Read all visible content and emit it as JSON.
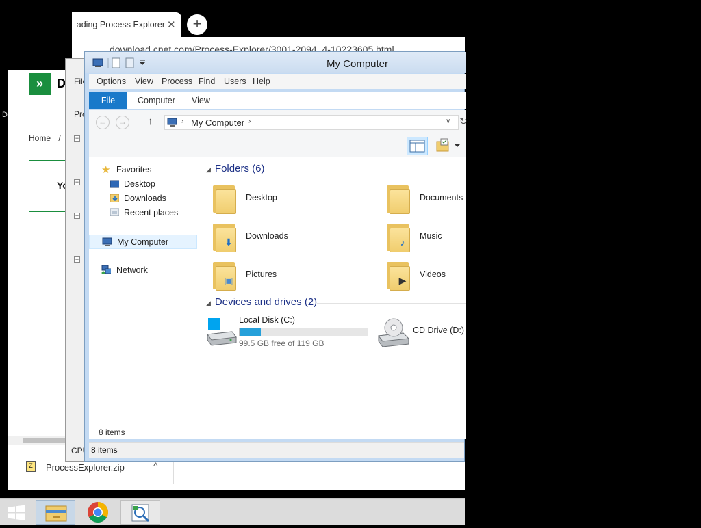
{
  "browser": {
    "tab_title": "Thank you for downloading Process Explorer",
    "tab_close_glyph": "✕",
    "new_tab_glyph": "+",
    "url": "download.cnet.com/Process-Explorer/3001-2094_4-10223605.html",
    "page_logo_glyph": "»",
    "page_logo_text": "D",
    "breadcrumb_home": "Home",
    "breadcrumb_sep": "/",
    "page_box_text": "Yo",
    "left_edge_text": "D",
    "download_file": "ProcessExplorer.zip",
    "download_chevron": "^"
  },
  "procexp": {
    "menu_file": "File",
    "col_process": "Proc",
    "cpu_label": "CPU"
  },
  "explorer": {
    "title": "My Computer",
    "menu": [
      "Options",
      "View",
      "Process",
      "Find",
      "Users",
      "Help"
    ],
    "ribbon_tabs": {
      "file": "File",
      "computer": "Computer",
      "view": "View"
    },
    "address": "My Computer",
    "address_sep": "›",
    "nav": {
      "favorites": "Favorites",
      "desktop": "Desktop",
      "downloads": "Downloads",
      "recent": "Recent places",
      "my_computer": "My Computer",
      "network": "Network"
    },
    "folders_header": "Folders (6)",
    "folders": [
      {
        "name": "Desktop",
        "badge": ""
      },
      {
        "name": "Documents",
        "badge": ""
      },
      {
        "name": "Downloads",
        "badge": "⬇"
      },
      {
        "name": "Music",
        "badge": "♪"
      },
      {
        "name": "Pictures",
        "badge": "▣"
      },
      {
        "name": "Videos",
        "badge": "▶"
      }
    ],
    "devices_header": "Devices and drives (2)",
    "drive_c": {
      "name": "Local Disk (C:)",
      "free": "99.5 GB free of 119 GB",
      "used_fraction": 0.164
    },
    "drive_d": {
      "name": "CD Drive (D:)"
    },
    "status_inner": "8 items",
    "status_outer": "8 items"
  },
  "colors": {
    "accent": "#1979ca",
    "drive_bar": "#26a0da",
    "group_header": "#1e3287"
  }
}
